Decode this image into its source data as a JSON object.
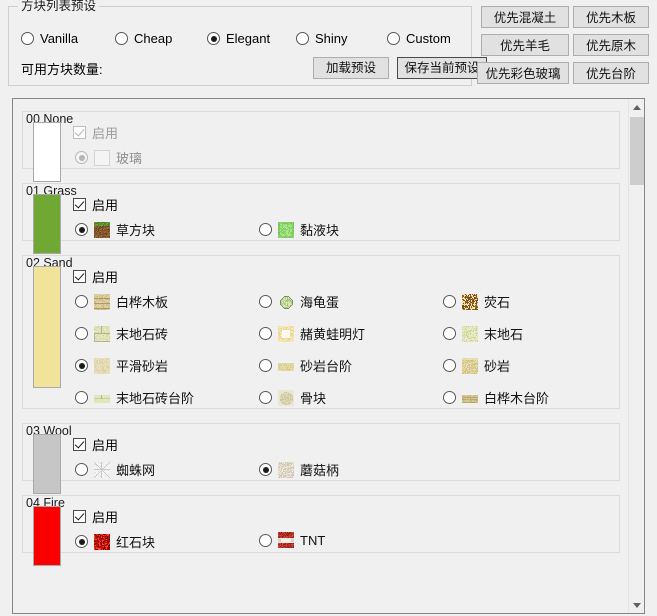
{
  "preset": {
    "title": "方块列表预设",
    "options": [
      {
        "label": "Vanilla",
        "checked": false
      },
      {
        "label": "Cheap",
        "checked": false
      },
      {
        "label": "Elegant",
        "checked": true
      },
      {
        "label": "Shiny",
        "checked": false
      },
      {
        "label": "Custom",
        "checked": false
      }
    ],
    "count_label": "可用方块数量:",
    "count_value": "",
    "load_button": "加载预设",
    "save_button": "保存当前预设"
  },
  "priority_buttons": [
    {
      "label": "优先混凝土"
    },
    {
      "label": "优先木板"
    },
    {
      "label": "优先羊毛"
    },
    {
      "label": "优先原木"
    },
    {
      "label": "优先彩色玻璃"
    },
    {
      "label": "优先台阶"
    }
  ],
  "enable_label": "启用",
  "colors": {
    "swatch_none": "#ffffff",
    "swatch_grass": "#6fa832",
    "swatch_sand": "#f2e39b",
    "swatch_wool": "#c6c6c6",
    "swatch_fire": "#fa0000",
    "button_face": "#e1e1e1",
    "panel_bg": "#f0f0f0",
    "groupbox_border": "#dcdcdc"
  },
  "groups": [
    {
      "title": "00 None",
      "swatch": "#ffffff",
      "enabled": true,
      "disabled": true,
      "options": [
        {
          "label": "玻璃",
          "checked": true,
          "col": 0,
          "row": 0,
          "tex": "glass-texture",
          "disabled": true,
          "blank": true
        }
      ]
    },
    {
      "title": "01 Grass",
      "swatch": "#6fa832",
      "enabled": true,
      "disabled": false,
      "options": [
        {
          "label": "草方块",
          "checked": true,
          "col": 0,
          "row": 0,
          "tex": "grass-block-texture"
        },
        {
          "label": "黏液块",
          "checked": false,
          "col": 1,
          "row": 0,
          "tex": "slime-block-texture"
        }
      ]
    },
    {
      "title": "02 Sand",
      "swatch": "#f2e39b",
      "enabled": true,
      "disabled": false,
      "options": [
        {
          "label": "白桦木板",
          "checked": false,
          "col": 0,
          "row": 0,
          "tex": "birch-planks-texture"
        },
        {
          "label": "海龟蛋",
          "checked": false,
          "col": 1,
          "row": 0,
          "tex": "turtle-egg-texture"
        },
        {
          "label": "荧石",
          "checked": false,
          "col": 2,
          "row": 0,
          "tex": "glowstone-texture"
        },
        {
          "label": "末地石砖",
          "checked": false,
          "col": 0,
          "row": 1,
          "tex": "end-stone-bricks-texture"
        },
        {
          "label": "赭黄蛙明灯",
          "checked": false,
          "col": 1,
          "row": 1,
          "tex": "ochre-froglight-texture"
        },
        {
          "label": "末地石",
          "checked": false,
          "col": 2,
          "row": 1,
          "tex": "end-stone-texture"
        },
        {
          "label": "平滑砂岩",
          "checked": true,
          "col": 0,
          "row": 2,
          "tex": "smooth-sandstone-texture"
        },
        {
          "label": "砂岩台阶",
          "checked": false,
          "col": 1,
          "row": 2,
          "tex": "sandstone-slab-texture",
          "slab": true
        },
        {
          "label": "砂岩",
          "checked": false,
          "col": 2,
          "row": 2,
          "tex": "sandstone-texture"
        },
        {
          "label": "末地石砖台阶",
          "checked": false,
          "col": 0,
          "row": 3,
          "tex": "end-stone-brick-slab-texture",
          "slab": true
        },
        {
          "label": "骨块",
          "checked": false,
          "col": 1,
          "row": 3,
          "tex": "bone-block-texture"
        },
        {
          "label": "白桦木台阶",
          "checked": false,
          "col": 2,
          "row": 3,
          "tex": "birch-slab-texture",
          "slab": true
        }
      ]
    },
    {
      "title": "03 Wool",
      "swatch": "#c6c6c6",
      "enabled": true,
      "disabled": false,
      "options": [
        {
          "label": "蜘蛛网",
          "checked": false,
          "col": 0,
          "row": 0,
          "tex": "cobweb-texture"
        },
        {
          "label": "蘑菇柄",
          "checked": true,
          "col": 1,
          "row": 0,
          "tex": "mushroom-stem-texture"
        }
      ]
    },
    {
      "title": "04 Fire",
      "swatch": "#fa0000",
      "enabled": true,
      "disabled": false,
      "options": [
        {
          "label": "红石块",
          "checked": true,
          "col": 0,
          "row": 0,
          "tex": "redstone-block-texture"
        },
        {
          "label": "TNT",
          "checked": false,
          "col": 1,
          "row": 0,
          "tex": "tnt-texture"
        }
      ]
    }
  ],
  "scrollbar": {
    "up_arrow": "scroll-up-arrow",
    "down_arrow": "scroll-down-arrow"
  }
}
